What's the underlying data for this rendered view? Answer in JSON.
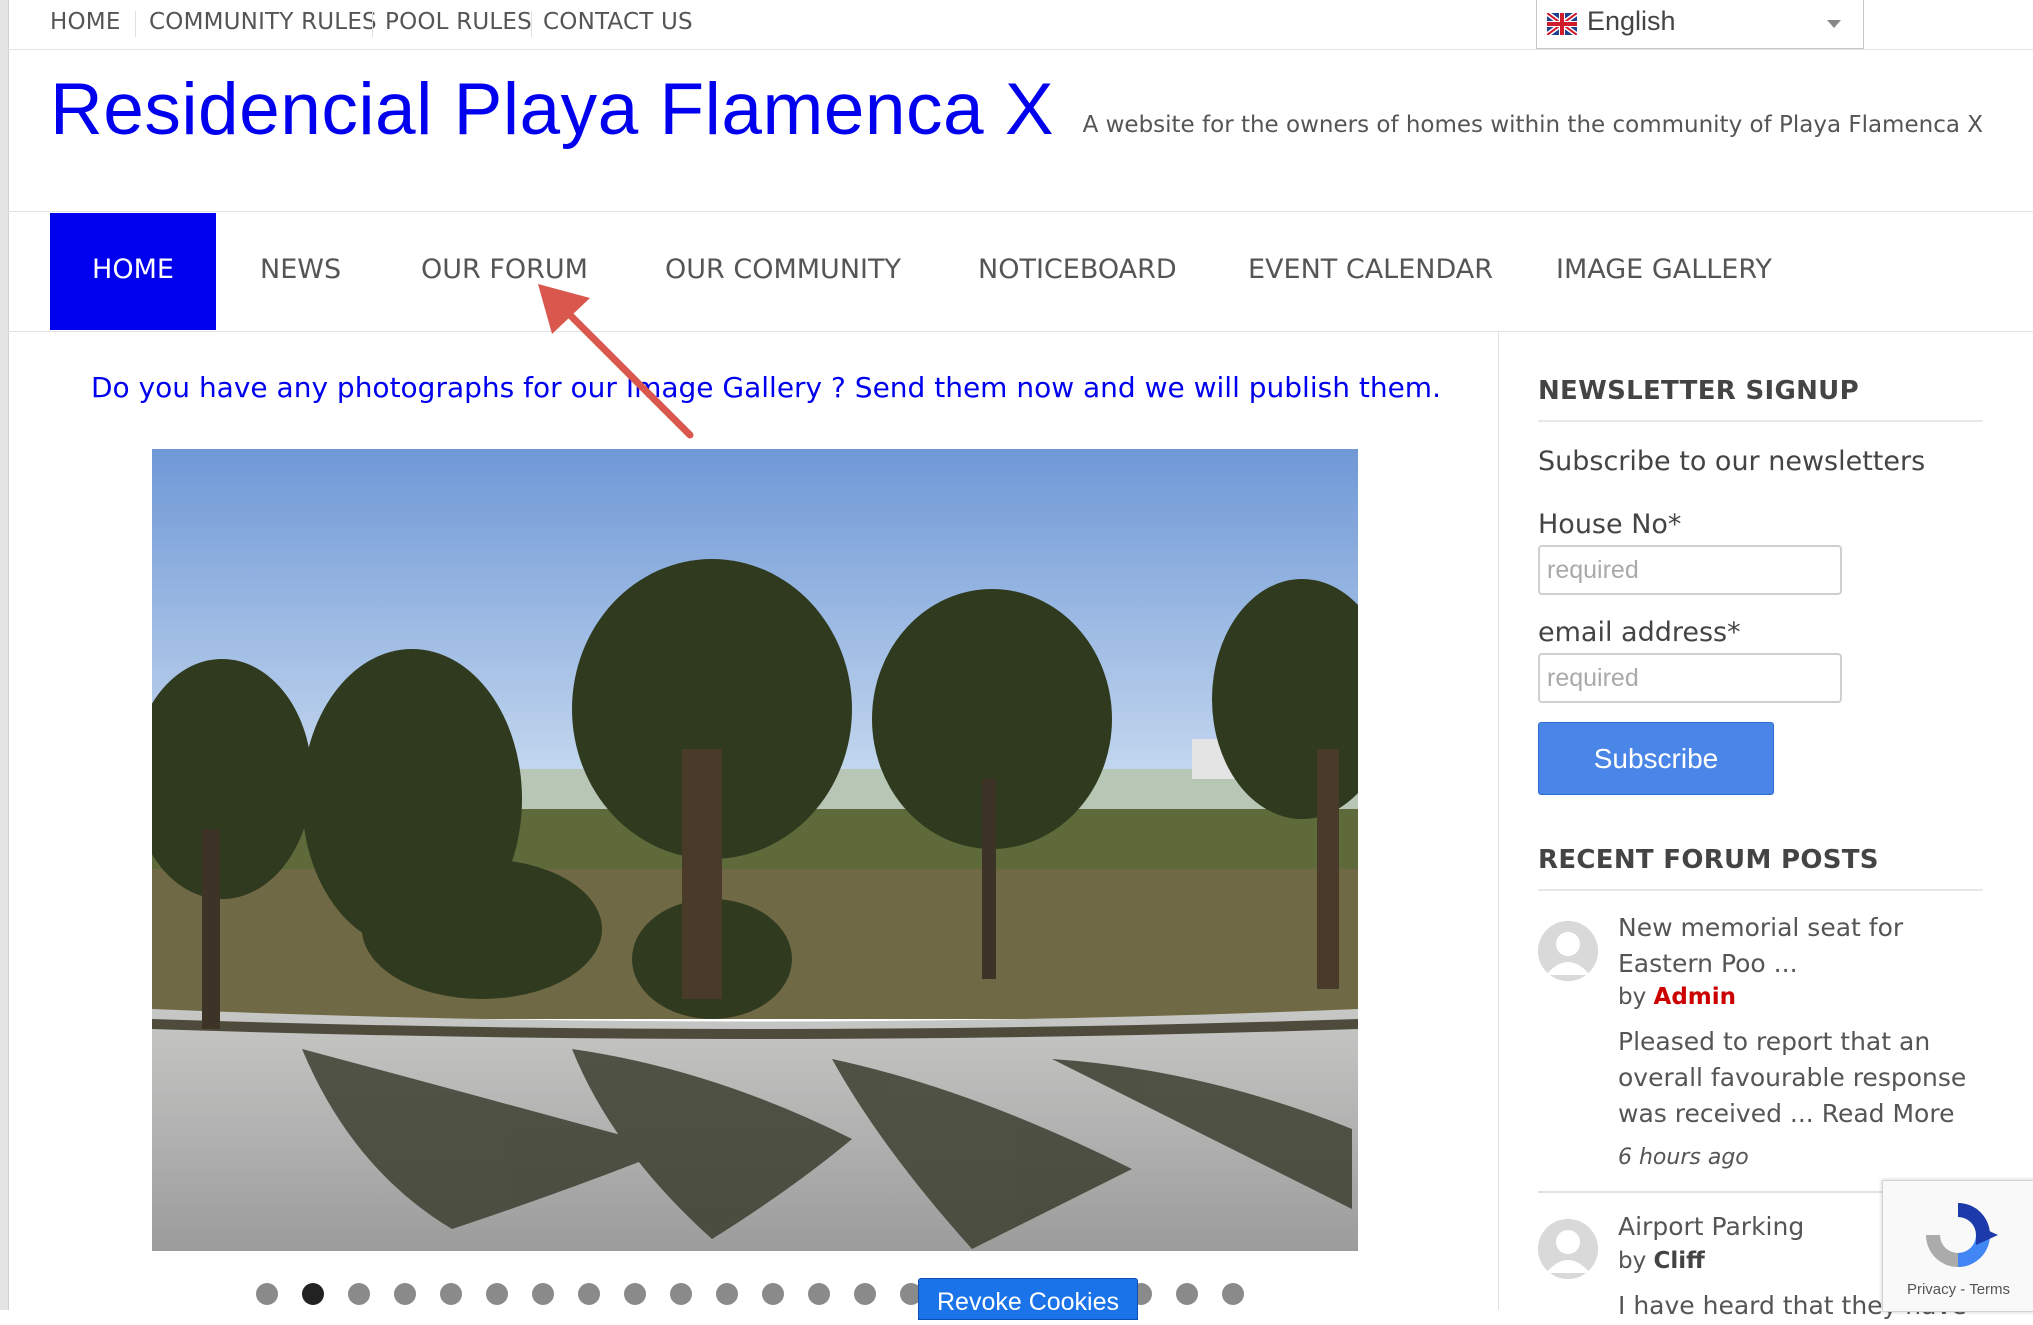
{
  "top_nav": {
    "items": [
      "HOME",
      "COMMUNITY RULES",
      "POOL RULES",
      "CONTACT US"
    ]
  },
  "language": {
    "selected": "English",
    "flag_icon": "uk-flag-icon"
  },
  "header": {
    "site_title": "Residencial Playa Flamenca X",
    "tagline": "A website for the owners of homes within the community of Playa Flamenca X"
  },
  "main_nav": {
    "items": [
      "HOME",
      "NEWS",
      "OUR FORUM",
      "OUR COMMUNITY",
      "NOTICEBOARD",
      "EVENT CALENDAR",
      "IMAGE GALLERY"
    ],
    "active": "HOME"
  },
  "content": {
    "promo_text": "Do you have any photographs for our Image Gallery ? Send them now and we will publish them.",
    "slider": {
      "dot_count": 22,
      "active_dot": 2
    }
  },
  "cookie": {
    "revoke_label": "Revoke Cookies"
  },
  "newsletter": {
    "title": "NEWSLETTER SIGNUP",
    "intro": "Subscribe to our newsletters",
    "house_label": "House No*",
    "house_placeholder": "required",
    "email_label": "email address*",
    "email_placeholder": "required",
    "subscribe_label": "Subscribe"
  },
  "forum": {
    "title": "RECENT FORUM POSTS",
    "posts": [
      {
        "title": "New memorial seat for Eastern Poo ...",
        "by": "by",
        "author": "Admin",
        "excerpt": "Pleased to report that an overall favourable response was received ...",
        "read_more": "Read More",
        "time": "6 hours ago"
      },
      {
        "title": "Airport Parking",
        "by": "by",
        "author": "Cliff",
        "excerpt": "I have heard that they have"
      }
    ]
  },
  "recaptcha": {
    "privacy": "Privacy",
    "sep": " - ",
    "terms": "Terms"
  },
  "colors": {
    "brand_blue": "#0000ee",
    "admin_red": "#cc0000",
    "button_blue": "#4a86e8",
    "annotation_arrow": "#d9574d"
  }
}
